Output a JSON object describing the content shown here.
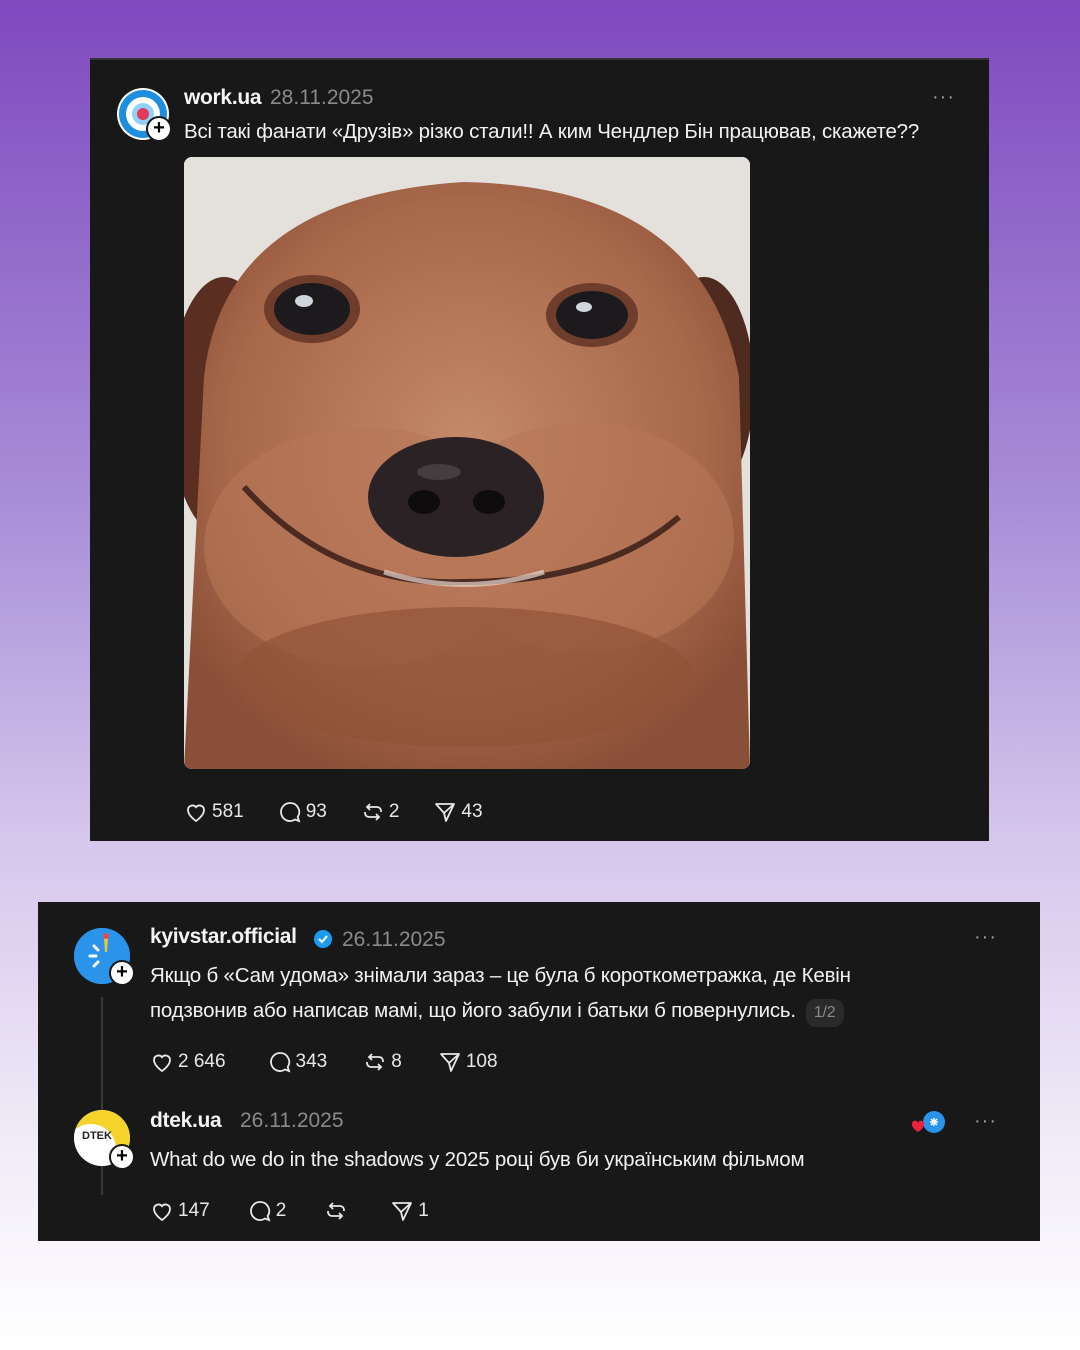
{
  "posts": [
    {
      "username": "work.ua",
      "date": "28.11.2025",
      "more": "···",
      "text": "Всі такі фанати «Друзів» різко стали!! А ким Чендлер Бін працював, скажете??",
      "image": "dog-meme",
      "likes": "581",
      "comments": "93",
      "reposts": "2",
      "shares": "43"
    },
    {
      "username": "kyivstar.official",
      "verified": true,
      "date": "26.11.2025",
      "more": "···",
      "text_line1": "Якщо б «Сам удома» знімали зараз – це була б короткометражка, де Кевін",
      "text_line2": "подзвонив або написав мамі, що його забули і батьки б повернулись.",
      "pager": "1/2",
      "likes": "2 646",
      "comments": "343",
      "reposts": "8",
      "shares": "108"
    },
    {
      "username": "dtek.ua",
      "date": "26.11.2025",
      "more": "···",
      "avatar_text": "DTEK",
      "text": "What do we do in the shadows у 2025 році був би українським фільмом",
      "likes": "147",
      "comments": "2",
      "shares": "1"
    }
  ],
  "colors": {
    "card_bg": "#181818",
    "muted": "#8a8a8a",
    "verified": "#1d9bf0",
    "kyivstar": "#1f8fe6",
    "dtek": "#f6d32a"
  }
}
